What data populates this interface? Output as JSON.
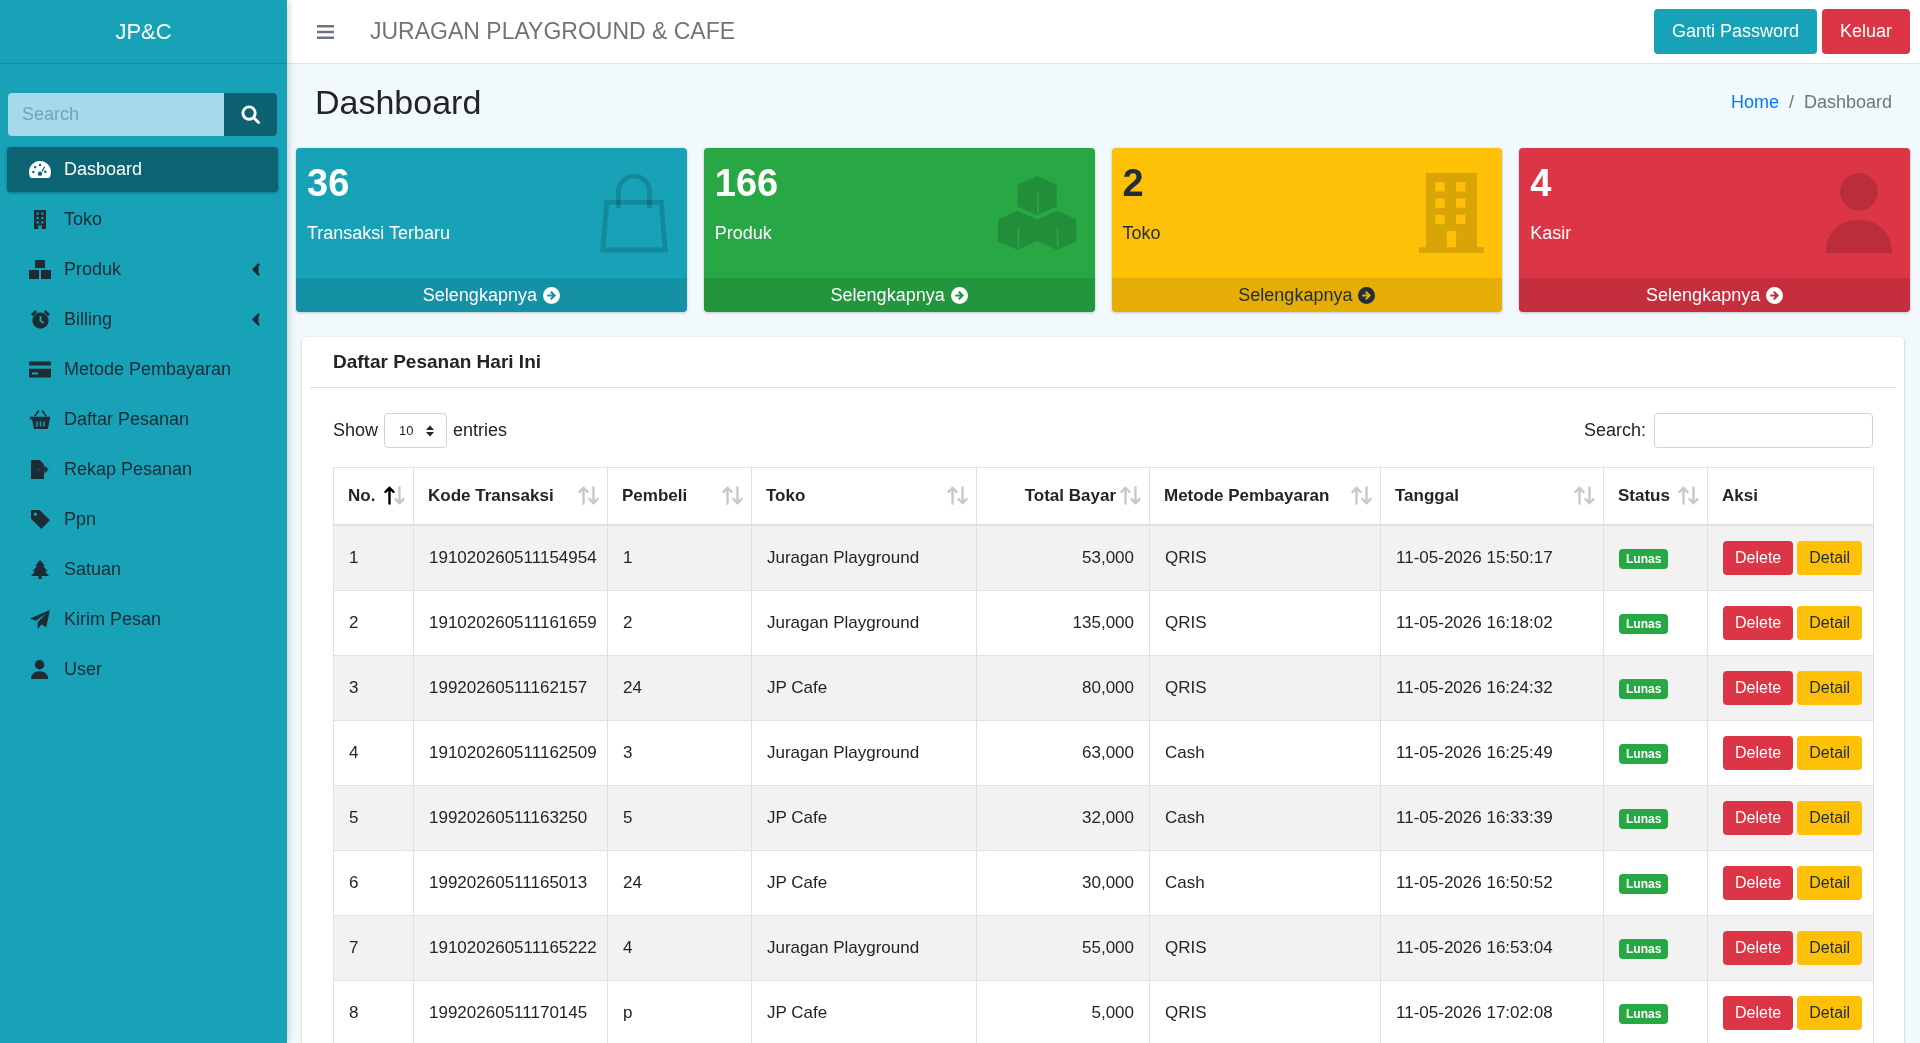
{
  "sidebar": {
    "brand": "JP&C",
    "search": {
      "placeholder": "Search"
    },
    "items": [
      {
        "label": "Dasboard",
        "selected": true,
        "submenu": false
      },
      {
        "label": "Toko",
        "selected": false,
        "submenu": false
      },
      {
        "label": "Produk",
        "selected": false,
        "submenu": true
      },
      {
        "label": "Billing",
        "selected": false,
        "submenu": true
      },
      {
        "label": "Metode Pembayaran",
        "selected": false,
        "submenu": false
      },
      {
        "label": "Daftar Pesanan",
        "selected": false,
        "submenu": false
      },
      {
        "label": "Rekap Pesanan",
        "selected": false,
        "submenu": false
      },
      {
        "label": "Ppn",
        "selected": false,
        "submenu": false
      },
      {
        "label": "Satuan",
        "selected": false,
        "submenu": false
      },
      {
        "label": "Kirim Pesan",
        "selected": false,
        "submenu": false
      },
      {
        "label": "User",
        "selected": false,
        "submenu": false
      }
    ]
  },
  "header": {
    "title": "JURAGAN PLAYGROUND & CAFE",
    "buttons": [
      {
        "label": "Ganti Password",
        "kind": "info"
      },
      {
        "label": "Keluar",
        "kind": "danger"
      }
    ]
  },
  "page": {
    "title": "Dashboard",
    "breadcrumb": [
      {
        "label": "Home",
        "selected": false
      },
      {
        "label": "Dashboard",
        "selected": true
      }
    ],
    "breadcrumb_separator": "/"
  },
  "cards": [
    {
      "value": "36",
      "label": "Transaksi Terbaru",
      "link": "Selengkapnya",
      "color": "#17a2b8"
    },
    {
      "value": "166",
      "label": "Produk",
      "link": "Selengkapnya",
      "color": "#28a745"
    },
    {
      "value": "2",
      "label": "Toko",
      "link": "Selengkapnya",
      "color": "#ffc107"
    },
    {
      "value": "4",
      "label": "Kasir",
      "link": "Selengkapnya",
      "color": "#dc3545"
    }
  ],
  "orders": {
    "title": "Daftar Pesanan Hari Ini",
    "length_menu": {
      "before": "Show",
      "value": "10",
      "after": "entries"
    },
    "search": {
      "label": "Search:"
    },
    "columns": [
      {
        "label": "No.",
        "kind": "text",
        "sortable": true,
        "sorted": true
      },
      {
        "label": "Kode Transaksi",
        "kind": "text",
        "sortable": true,
        "sorted": false
      },
      {
        "label": "Pembeli",
        "kind": "text",
        "sortable": true,
        "sorted": false
      },
      {
        "label": "Toko",
        "kind": "text",
        "sortable": true,
        "sorted": false
      },
      {
        "label": "Total Bayar",
        "kind": "number",
        "sortable": true,
        "sorted": false
      },
      {
        "label": "Metode Pembayaran",
        "kind": "text",
        "sortable": true,
        "sorted": false
      },
      {
        "label": "Tanggal",
        "kind": "text",
        "sortable": true,
        "sorted": false
      },
      {
        "label": "Status",
        "kind": "badge",
        "sortable": true,
        "sorted": false
      },
      {
        "label": "Aksi",
        "kind": "actions",
        "sortable": false,
        "sorted": false
      }
    ],
    "rows": [
      {
        "cells": [
          "1",
          "191020260511154954",
          "1",
          "Juragan Playground",
          "53,000",
          "QRIS",
          "11-05-2026 15:50:17"
        ],
        "status": "Lunas",
        "actions": [
          {
            "label": "Delete",
            "kind": "danger"
          },
          {
            "label": "Detail",
            "kind": "warning"
          }
        ]
      },
      {
        "cells": [
          "2",
          "191020260511161659",
          "2",
          "Juragan Playground",
          "135,000",
          "QRIS",
          "11-05-2026 16:18:02"
        ],
        "status": "Lunas",
        "actions": [
          {
            "label": "Delete",
            "kind": "danger"
          },
          {
            "label": "Detail",
            "kind": "warning"
          }
        ]
      },
      {
        "cells": [
          "3",
          "19920260511162157",
          "24",
          "JP Cafe",
          "80,000",
          "QRIS",
          "11-05-2026 16:24:32"
        ],
        "status": "Lunas",
        "actions": [
          {
            "label": "Delete",
            "kind": "danger"
          },
          {
            "label": "Detail",
            "kind": "warning"
          }
        ]
      },
      {
        "cells": [
          "4",
          "191020260511162509",
          "3",
          "Juragan Playground",
          "63,000",
          "Cash",
          "11-05-2026 16:25:49"
        ],
        "status": "Lunas",
        "actions": [
          {
            "label": "Delete",
            "kind": "danger"
          },
          {
            "label": "Detail",
            "kind": "warning"
          }
        ]
      },
      {
        "cells": [
          "5",
          "19920260511163250",
          "5",
          "JP Cafe",
          "32,000",
          "Cash",
          "11-05-2026 16:33:39"
        ],
        "status": "Lunas",
        "actions": [
          {
            "label": "Delete",
            "kind": "danger"
          },
          {
            "label": "Detail",
            "kind": "warning"
          }
        ]
      },
      {
        "cells": [
          "6",
          "19920260511165013",
          "24",
          "JP Cafe",
          "30,000",
          "Cash",
          "11-05-2026 16:50:52"
        ],
        "status": "Lunas",
        "actions": [
          {
            "label": "Delete",
            "kind": "danger"
          },
          {
            "label": "Detail",
            "kind": "warning"
          }
        ]
      },
      {
        "cells": [
          "7",
          "191020260511165222",
          "4",
          "Juragan Playground",
          "55,000",
          "QRIS",
          "11-05-2026 16:53:04"
        ],
        "status": "Lunas",
        "actions": [
          {
            "label": "Delete",
            "kind": "danger"
          },
          {
            "label": "Detail",
            "kind": "warning"
          }
        ]
      },
      {
        "cells": [
          "8",
          "19920260511170145",
          "p",
          "JP Cafe",
          "5,000",
          "QRIS",
          "11-05-2026 17:02:08"
        ],
        "status": "Lunas",
        "actions": [
          {
            "label": "Delete",
            "kind": "danger"
          },
          {
            "label": "Detail",
            "kind": "warning"
          }
        ]
      }
    ]
  }
}
